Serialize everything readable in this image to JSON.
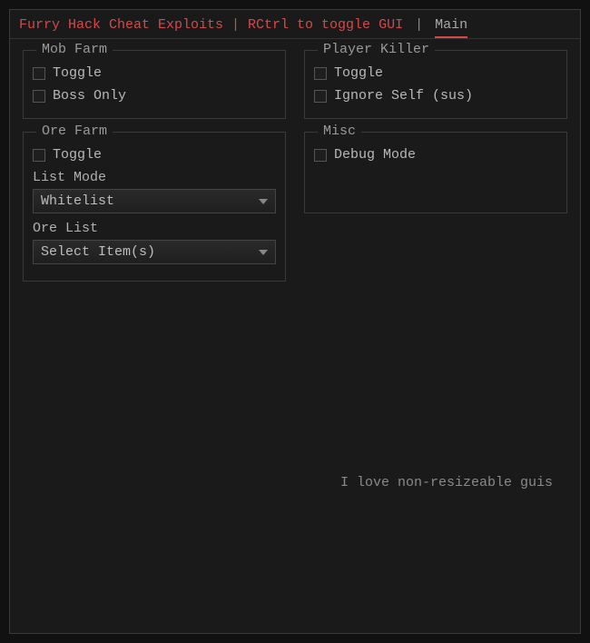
{
  "titlebar": {
    "title_red": "Furry Hack Cheat Exploits | RCtrl to toggle GUI",
    "separator": "|",
    "active_tab": "Main"
  },
  "groups": {
    "mob_farm": {
      "legend": "Mob Farm",
      "toggle_label": "Toggle",
      "boss_only_label": "Boss Only"
    },
    "ore_farm": {
      "legend": "Ore Farm",
      "toggle_label": "Toggle",
      "list_mode_label": "List Mode",
      "list_mode_value": "Whitelist",
      "ore_list_label": "Ore List",
      "ore_list_value": "Select Item(s)"
    },
    "player_killer": {
      "legend": "Player Killer",
      "toggle_label": "Toggle",
      "ignore_self_label": "Ignore Self (sus)"
    },
    "misc": {
      "legend": "Misc",
      "debug_mode_label": "Debug Mode"
    }
  },
  "footer": {
    "text": "I love non-resizeable guis"
  }
}
